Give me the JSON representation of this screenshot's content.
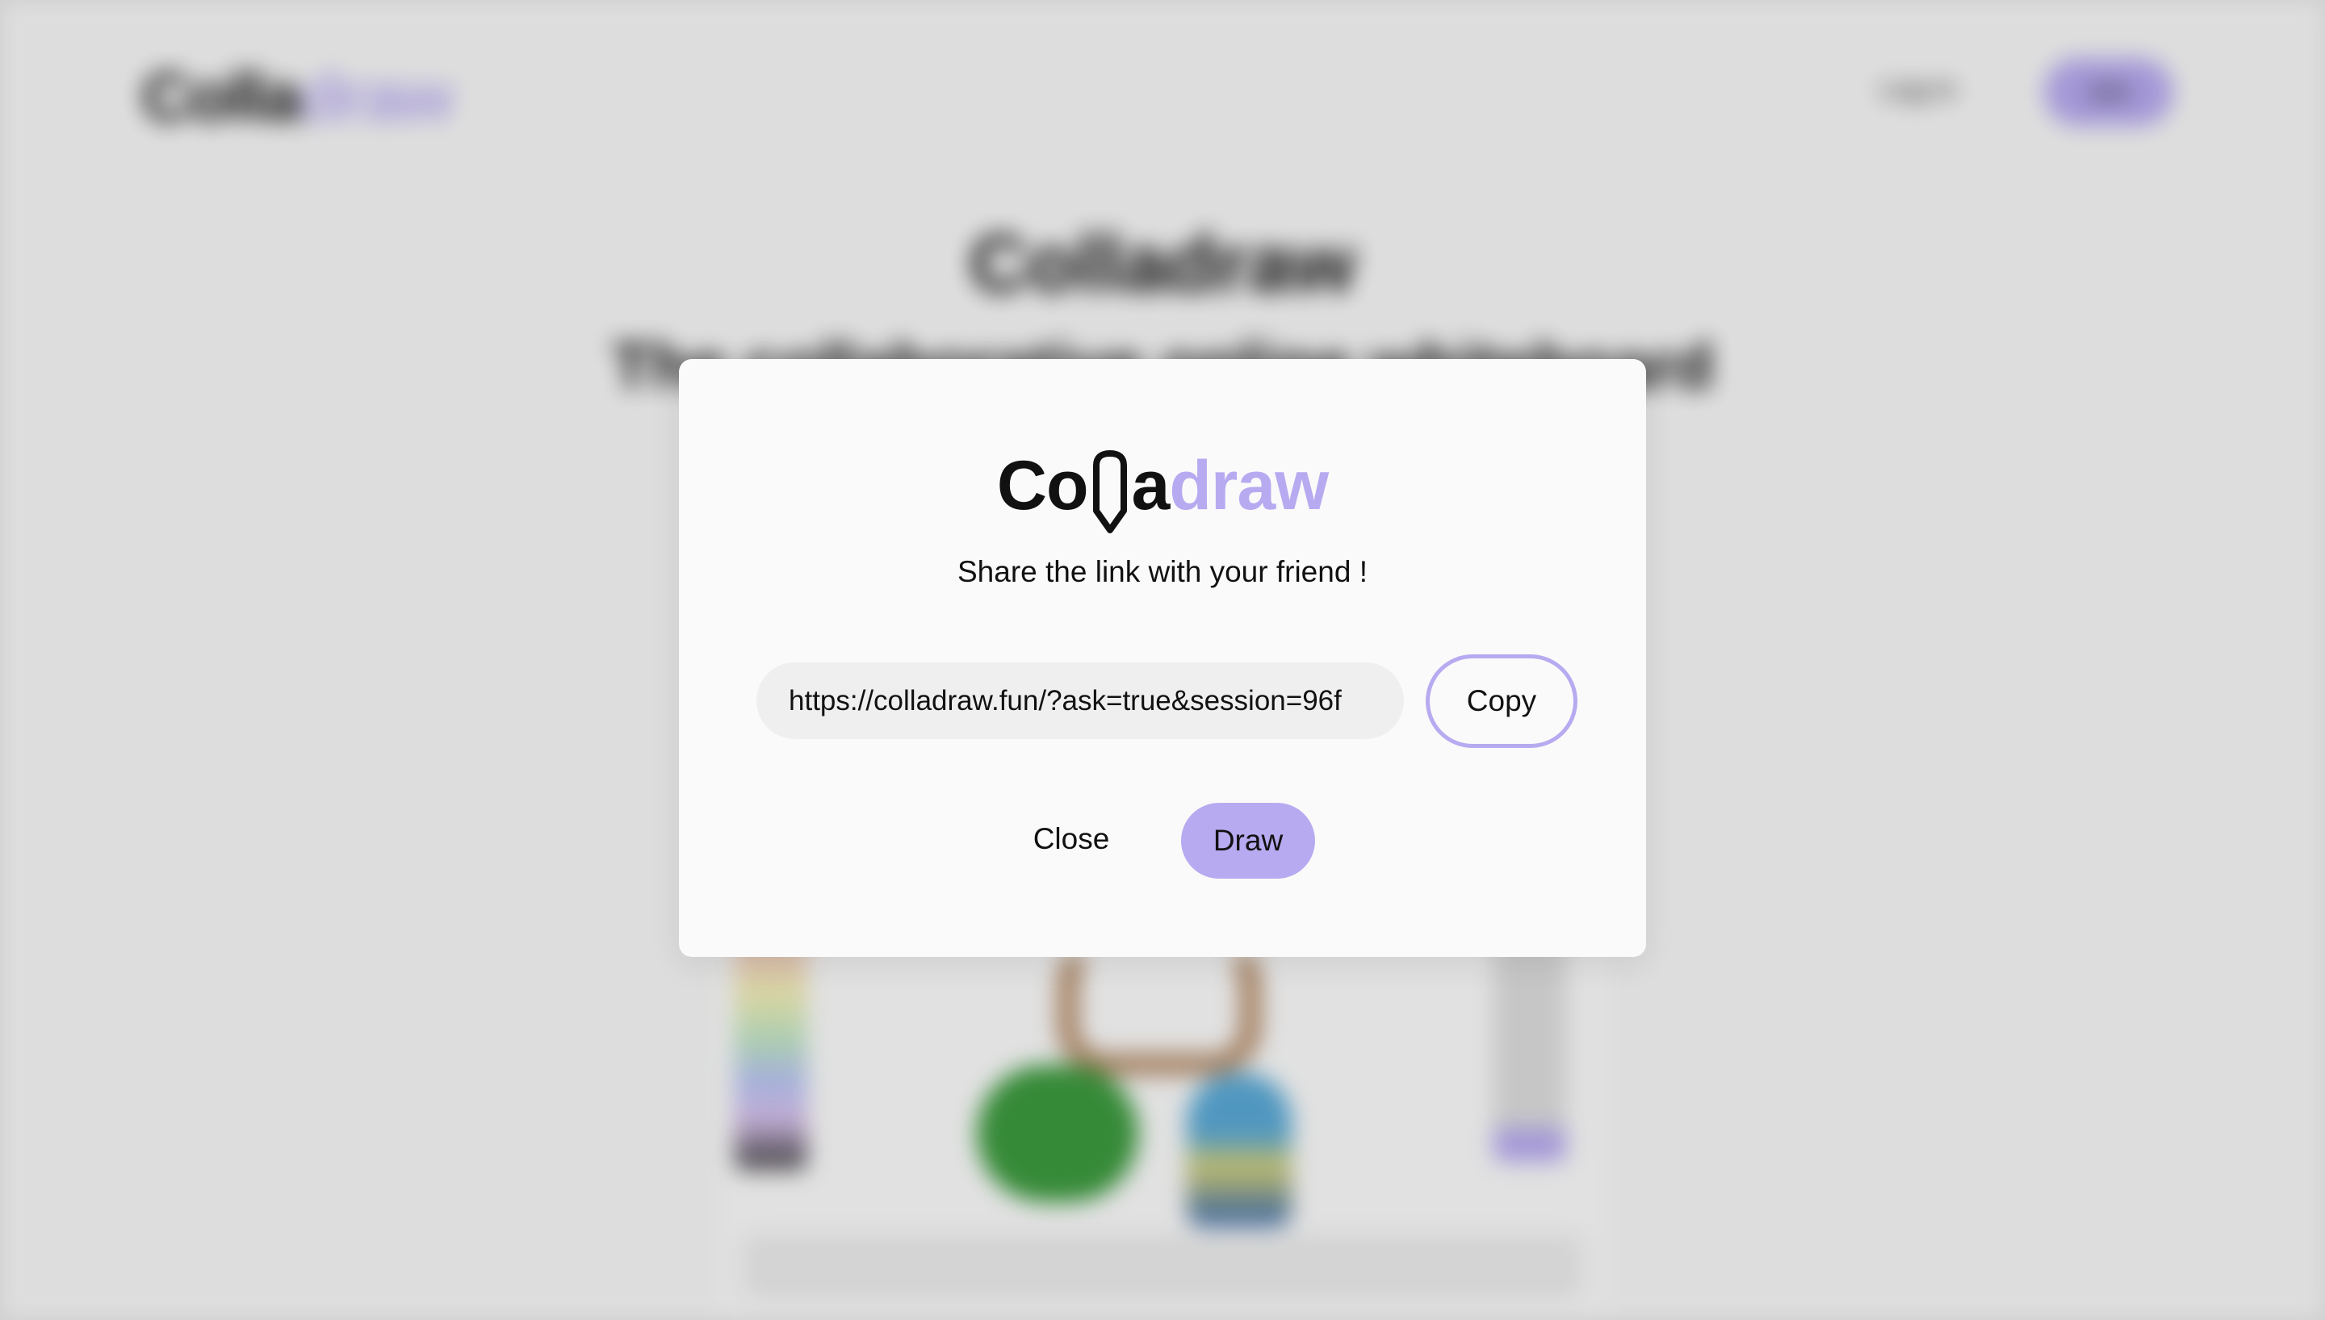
{
  "background": {
    "logo": {
      "dark": "Colla",
      "accent": "draw"
    },
    "login_label": "Log in",
    "join_label": "Join",
    "title": "Colladraw",
    "subtitle": "The collaborative online whiteboard"
  },
  "modal": {
    "logo": {
      "part1": "Co",
      "pencil_icon": "pencil-icon",
      "part2": "a",
      "part3": "draw"
    },
    "message": "Share the link with your friend !",
    "link_field": {
      "value": "https://colladraw.fun/?ask=true&session=96f"
    },
    "copy_label": "Copy",
    "close_label": "Close",
    "draw_label": "Draw"
  },
  "colors": {
    "accent": "#b7aaf0",
    "text": "#111111",
    "modal_bg": "#fafafa",
    "field_bg": "#efefef"
  }
}
